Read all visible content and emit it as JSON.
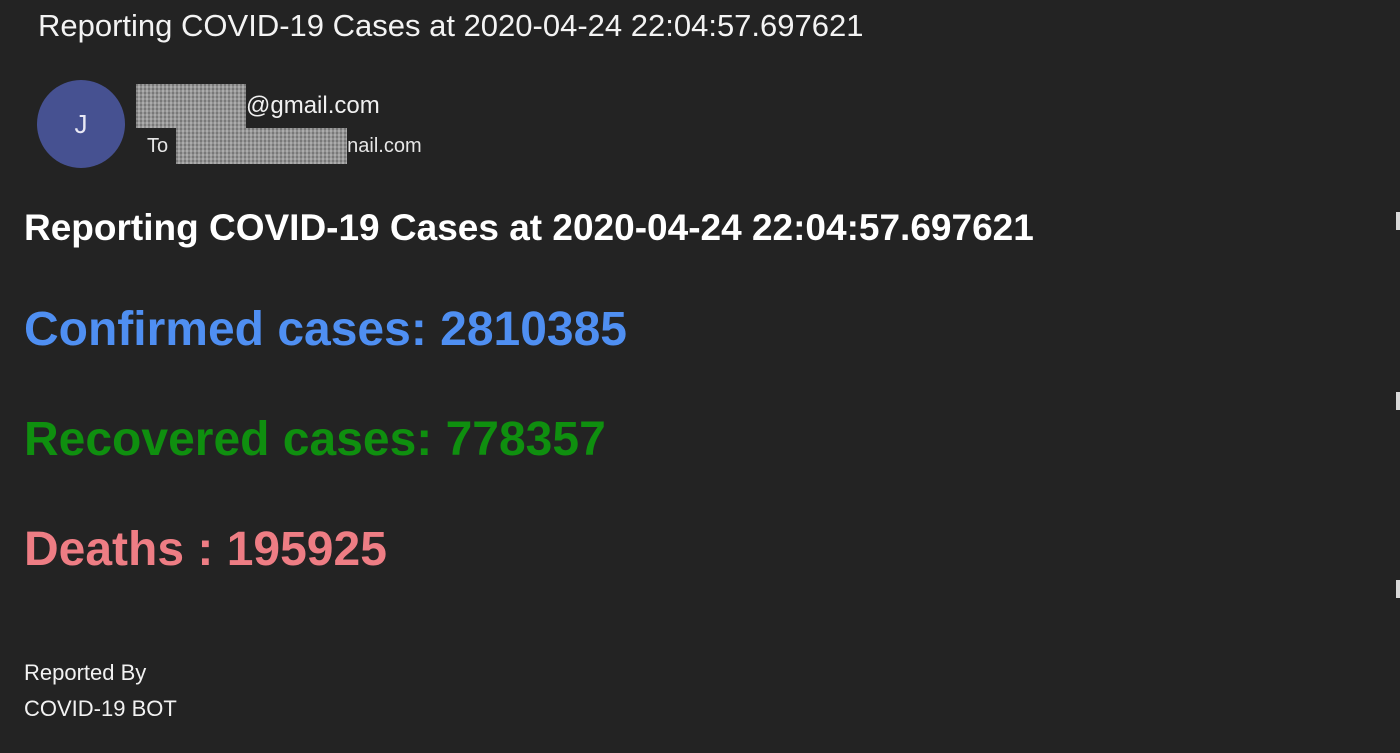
{
  "email": {
    "subject": "Reporting COVID-19 Cases at 2020-04-24 22:04:57.697621",
    "sender": {
      "avatar_initial": "J",
      "address_suffix": "@gmail.com"
    },
    "recipient": {
      "to_label": "To",
      "address_suffix": "nail.com"
    }
  },
  "body": {
    "heading": "Reporting COVID-19 Cases at 2020-04-24 22:04:57.697621",
    "confirmed": "Confirmed cases: 2810385",
    "recovered": "Recovered cases: 778357",
    "deaths": "Deaths : 195925",
    "footer_line1": "Reported By",
    "footer_line2": "COVID-19 BOT"
  },
  "colors": {
    "background": "#232323",
    "avatar": "#465191",
    "confirmed": "#4f8ff2",
    "recovered": "#0f8f0f",
    "deaths": "#ee7d84"
  }
}
